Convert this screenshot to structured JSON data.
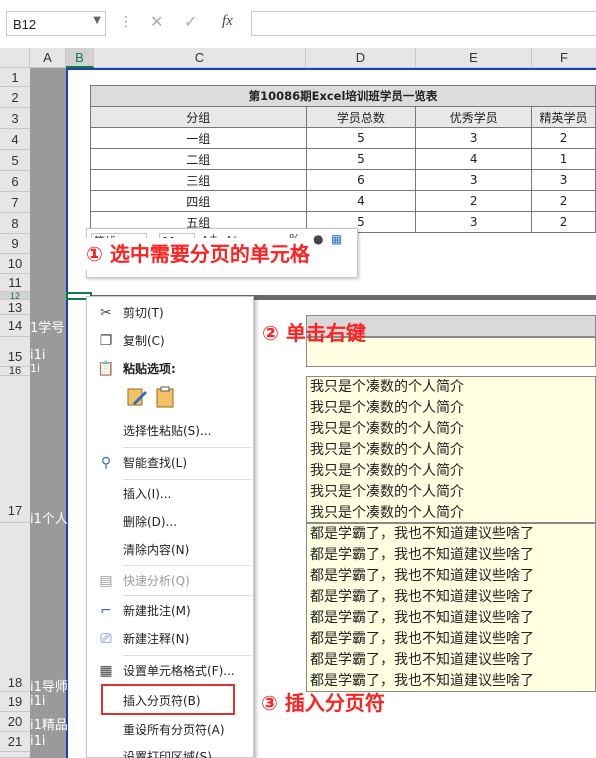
{
  "formula_bar": {
    "name_box": "B12",
    "cancel_icon": "✕",
    "enter_icon": "✓",
    "fx_label": "fx",
    "formula": ""
  },
  "columns": [
    "A",
    "B",
    "C",
    "D",
    "E",
    "F"
  ],
  "selected_column": "B",
  "rows_top": [
    "1",
    "2",
    "3",
    "4",
    "5",
    "6",
    "7",
    "8",
    "9",
    "10",
    "11",
    "12"
  ],
  "rows_bottom": [
    "13",
    "14",
    "15",
    "16",
    "17",
    "18",
    "19",
    "20",
    "21"
  ],
  "table": {
    "title": "第10086期Excel培训班学员一览表",
    "headers": [
      "分组",
      "学员总数",
      "优秀学员",
      "精英学员"
    ],
    "rows": [
      [
        "一组",
        "5",
        "3",
        "2"
      ],
      [
        "二组",
        "5",
        "4",
        "1"
      ],
      [
        "三组",
        "6",
        "3",
        "3"
      ],
      [
        "四组",
        "4",
        "2",
        "2"
      ],
      [
        "五组",
        "5",
        "3",
        "2"
      ]
    ]
  },
  "left_labels": {
    "r14": "1学号",
    "r15": "i1i",
    "r16": "1i",
    "r17": "i1个人",
    "r18": "i1导师",
    "r19": "i1i",
    "r20": "i1精品",
    "r21": "i1i"
  },
  "intro_lines": [
    "我只是个凑数的个人简介",
    "我只是个凑数的个人简介",
    "我只是个凑数的个人简介",
    "我只是个凑数的个人简介",
    "我只是个凑数的个人简介",
    "我只是个凑数的个人简介",
    "我只是个凑数的个人简介"
  ],
  "advice_lines": [
    "都是学霸了，我也不知道建议些啥了",
    "都是学霸了，我也不知道建议些啥了",
    "都是学霸了，我也不知道建议些啥了",
    "都是学霸了，我也不知道建议些啥了",
    "都是学霸了，我也不知道建议些啥了",
    "都是学霸了，我也不知道建议些啥了",
    "都是学霸了，我也不知道建议些啥了",
    "都是学霸了，我也不知道建议些啥了"
  ],
  "mini_toolbar": {
    "font": "等线",
    "size": "11"
  },
  "callouts": {
    "step1": "① 选中需要分页的单元格",
    "step2": "② 单击右键",
    "step3": "③ 插入分页符"
  },
  "context_menu": {
    "cut": "剪切(T)",
    "copy": "复制(C)",
    "paste_options": "粘贴选项:",
    "paste_special": "选择性粘贴(S)...",
    "smart_lookup": "智能查找(L)",
    "insert": "插入(I)...",
    "delete": "删除(D)...",
    "clear": "清除内容(N)",
    "quick_analysis": "快速分析(Q)",
    "new_comment": "新建批注(M)",
    "new_note": "新建注释(N)",
    "format_cells": "设置单元格格式(F)...",
    "insert_page_break": "插入分页符(B)",
    "reset_page_breaks": "重设所有分页符(A)",
    "set_print_area": "设置打印区域(S)"
  },
  "colors": {
    "excel_green": "#107c41",
    "callout_red": "#ff2020",
    "page_border": "#1f3fbf",
    "note_fill": "#ffffe1"
  }
}
